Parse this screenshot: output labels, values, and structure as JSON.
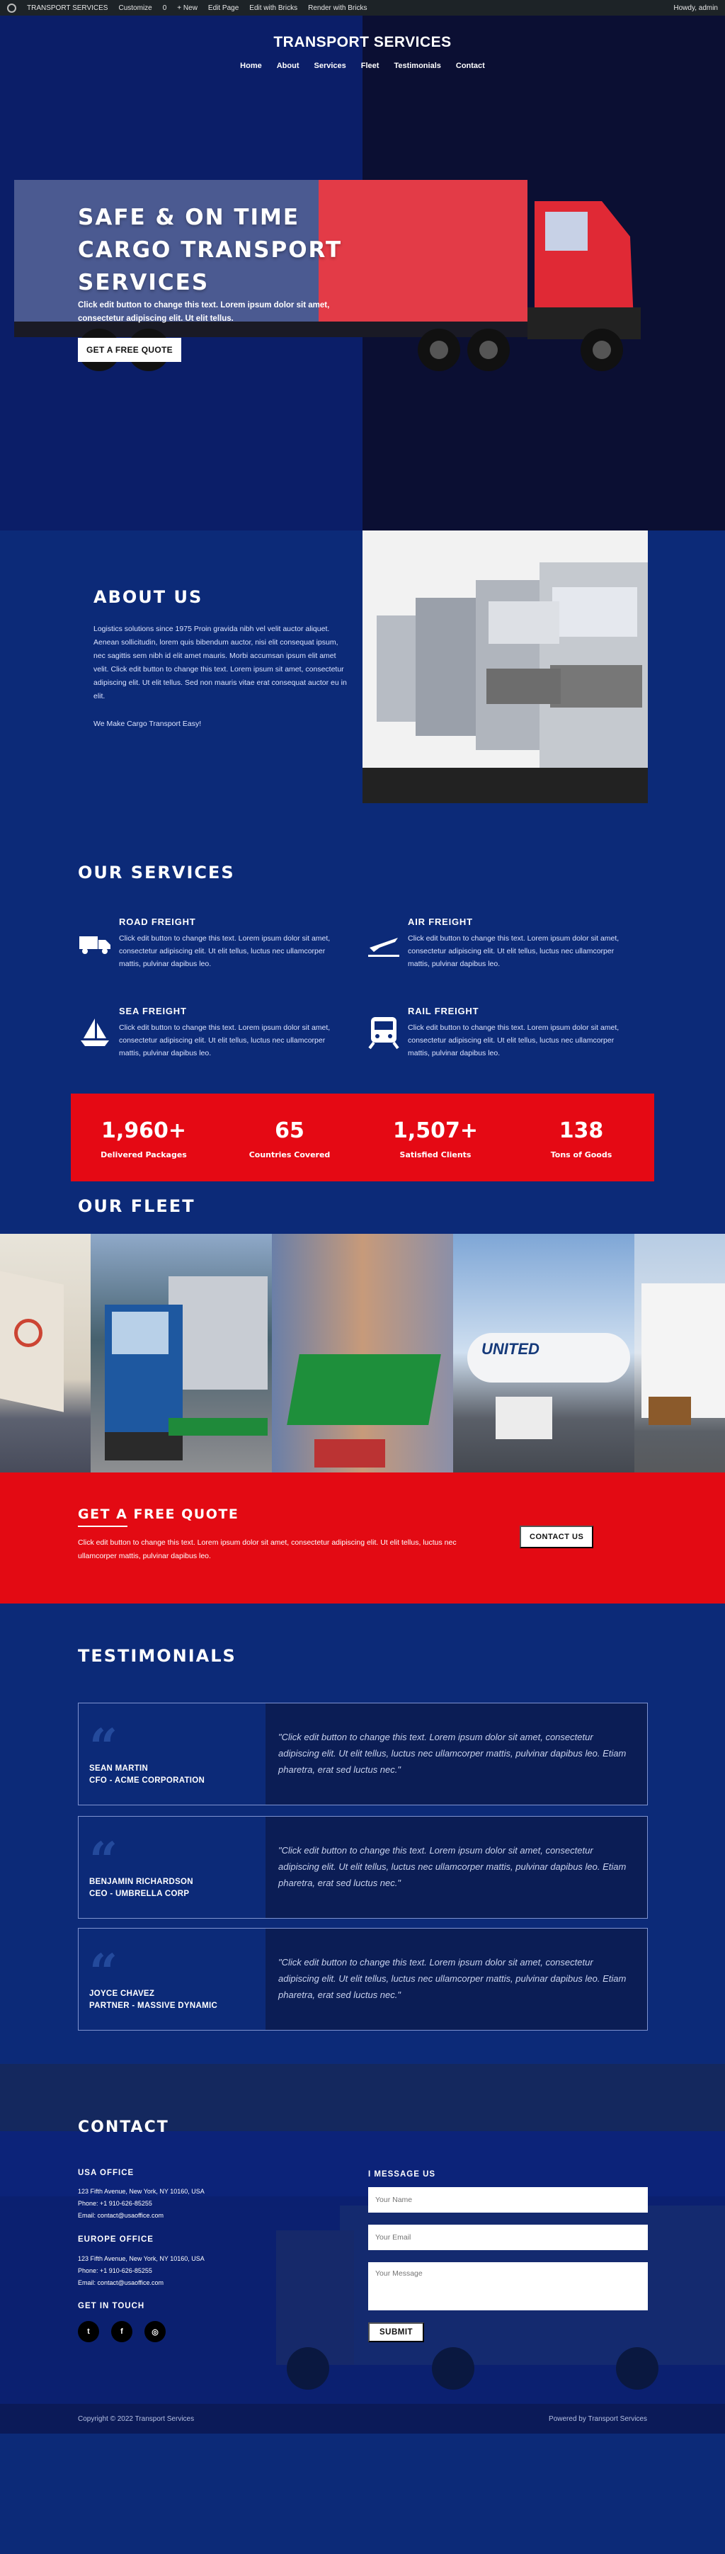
{
  "admin_bar": {
    "site": "TRANSPORT SERVICES",
    "customize": "Customize",
    "comments": "0",
    "new": "+ New",
    "edit_page": "Edit Page",
    "edit_bricks": "Edit with Bricks",
    "render_bricks": "Render with Bricks",
    "howdy": "Howdy, admin"
  },
  "header": {
    "title": "TRANSPORT SERVICES",
    "nav": [
      "Home",
      "About",
      "Services",
      "Fleet",
      "Testimonials",
      "Contact"
    ]
  },
  "hero": {
    "heading": "SAFE & ON TIME CARGO TRANSPORT SERVICES",
    "text": "Click edit button to change this text. Lorem ipsum dolor sit amet, consectetur adipiscing elit. Ut elit tellus.",
    "button": "GET A FREE QUOTE"
  },
  "about": {
    "heading": "ABOUT US",
    "text": "Logistics solutions since 1975 Proin gravida nibh vel velit auctor aliquet. Aenean sollicitudin, lorem quis bibendum auctor, nisi elit consequat ipsum, nec sagittis sem nibh id elit amet mauris. Morbi accumsan ipsum elit amet velit. Click edit button to change this text. Lorem ipsum sit amet, consectetur adipiscing elit. Ut elit tellus. Sed non mauris vitae erat consequat auctor eu in elit.",
    "tagline": "We Make Cargo Transport Easy!"
  },
  "services": {
    "heading": "OUR SERVICES",
    "items": [
      {
        "title": "ROAD FREIGHT",
        "icon": "truck-icon",
        "text": "Click edit button to change this text. Lorem ipsum dolor sit amet, consectetur adipiscing elit. Ut elit tellus, luctus nec ullamcorper mattis, pulvinar dapibus leo."
      },
      {
        "title": "AIR FREIGHT",
        "icon": "plane-icon",
        "text": "Click edit button to change this text. Lorem ipsum dolor sit amet, consectetur adipiscing elit. Ut elit tellus, luctus nec ullamcorper mattis, pulvinar dapibus leo."
      },
      {
        "title": "SEA FREIGHT",
        "icon": "sailboat-icon",
        "text": "Click edit button to change this text. Lorem ipsum dolor sit amet, consectetur adipiscing elit. Ut elit tellus, luctus nec ullamcorper mattis, pulvinar dapibus leo."
      },
      {
        "title": "RAIL FREIGHT",
        "icon": "train-icon",
        "text": "Click edit button to change this text. Lorem ipsum dolor sit amet, consectetur adipiscing elit. Ut elit tellus, luctus nec ullamcorper mattis, pulvinar dapibus leo."
      }
    ]
  },
  "stats": [
    {
      "value": "1,960+",
      "label": "Delivered Packages"
    },
    {
      "value": "65",
      "label": "Countries Covered"
    },
    {
      "value": "1,507+",
      "label": "Satisfied Clients"
    },
    {
      "value": "138",
      "label": "Tons of Goods"
    }
  ],
  "fleet": {
    "heading": "OUR FLEET",
    "plane_text": "UNITED"
  },
  "cta": {
    "heading": "GET A FREE QUOTE",
    "text": "Click edit button to change this text. Lorem ipsum dolor sit amet, consectetur adipiscing elit. Ut elit tellus, luctus nec ullamcorper mattis, pulvinar dapibus leo.",
    "button": "CONTACT US"
  },
  "testimonials": {
    "heading": "TESTIMONIALS",
    "items": [
      {
        "name": "SEAN MARTIN",
        "role": "CFO - ACME CORPORATION",
        "quote": "\"Click edit button to change this text. Lorem ipsum dolor sit amet, consectetur adipiscing elit. Ut elit tellus, luctus nec ullamcorper mattis, pulvinar dapibus leo. Etiam pharetra, erat sed luctus nec.\""
      },
      {
        "name": "BENJAMIN RICHARDSON",
        "role": "CEO - UMBRELLA CORP",
        "quote": "\"Click edit button to change this text. Lorem ipsum dolor sit amet, consectetur adipiscing elit. Ut elit tellus, luctus nec ullamcorper mattis, pulvinar dapibus leo. Etiam pharetra, erat sed luctus nec.\""
      },
      {
        "name": "JOYCE CHAVEZ",
        "role": "PARTNER - MASSIVE DYNAMIC",
        "quote": "\"Click edit button to change this text. Lorem ipsum dolor sit amet, consectetur adipiscing elit. Ut elit tellus, luctus nec ullamcorper mattis, pulvinar dapibus leo. Etiam pharetra, erat sed luctus nec.\""
      }
    ]
  },
  "contact": {
    "heading": "CONTACT",
    "usa_heading": "USA OFFICE",
    "usa_address": "123 Fifth Avenue, New York, NY 10160, USA",
    "usa_phone": "Phone: +1 910-626-85255",
    "usa_email": "Email: contact@usaoffice.com",
    "eu_heading": "EUROPE OFFICE",
    "eu_address": "123 Fifth Avenue, New York, NY 10160, USA",
    "eu_phone": "Phone: +1 910-626-85255",
    "eu_email": "Email: contact@usaoffice.com",
    "social_heading": "GET IN TOUCH",
    "message_heading": "I MESSAGE US",
    "name_placeholder": "Your Name",
    "email_placeholder": "Your Email",
    "message_placeholder": "Your Message",
    "submit": "SUBMIT"
  },
  "footer": {
    "copyright": "Copyright © 2022 Transport Services",
    "powered": "Powered by Transport Services"
  }
}
